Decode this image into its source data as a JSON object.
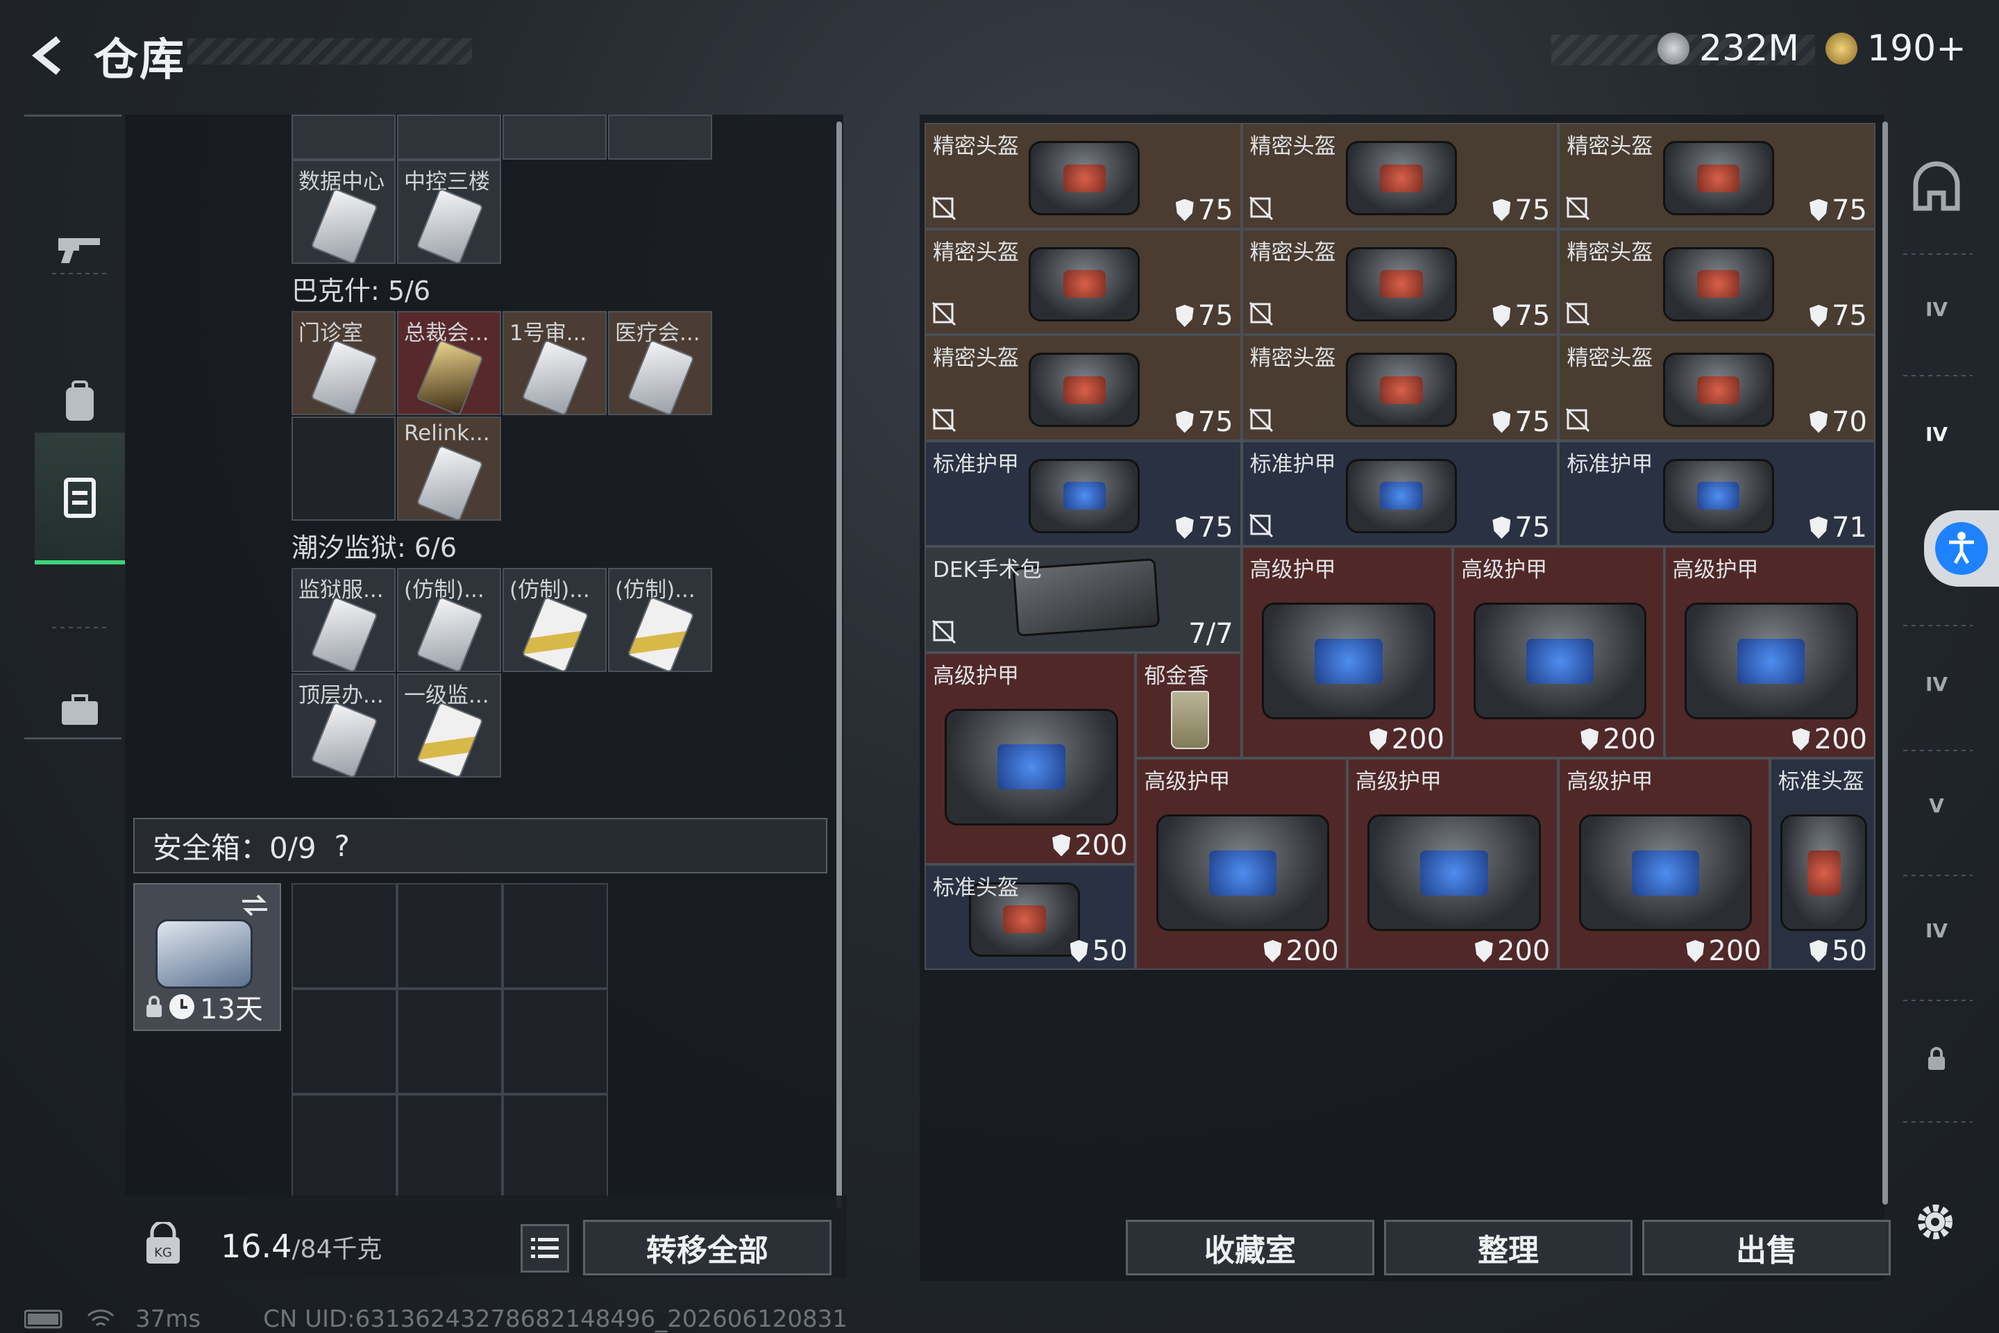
{
  "header": {
    "title": "仓库",
    "currency": [
      {
        "icon": "silver-coin-icon",
        "value": "232M"
      },
      {
        "icon": "gold-coin-icon",
        "value": "190+"
      }
    ]
  },
  "sidebar": {
    "items": [
      {
        "name": "weapon-icon"
      },
      {
        "name": "backpack-icon"
      },
      {
        "name": "armor-vest-icon",
        "active": true
      },
      {
        "name": "briefcase-icon"
      }
    ]
  },
  "stash": {
    "top_cells": [
      {
        "label": "数据中心"
      },
      {
        "label": "中控三楼"
      }
    ],
    "bakshi": {
      "title": "巴克什: 5/6",
      "cells": [
        {
          "label": "门诊室"
        },
        {
          "label": "总裁会..."
        },
        {
          "label": "1号审..."
        },
        {
          "label": "医疗会..."
        },
        {
          "label": "Relink..."
        }
      ]
    },
    "prison": {
      "title": "潮汐监狱: 6/6",
      "cells": [
        {
          "label": "监狱服..."
        },
        {
          "label": "(仿制)..."
        },
        {
          "label": "(仿制)..."
        },
        {
          "label": "(仿制)..."
        },
        {
          "label": "顶层办..."
        },
        {
          "label": "一级监..."
        }
      ]
    }
  },
  "safe_box": {
    "label": "安全箱：0/9",
    "help": "?",
    "item_timer": "13天"
  },
  "weight": {
    "current": "16.4",
    "max": "/84千克"
  },
  "buttons": {
    "transfer_all": "转移全部",
    "collection": "收藏室",
    "organize": "整理",
    "sell": "出售"
  },
  "items": [
    {
      "label": "精密头盔",
      "value": "75"
    },
    {
      "label": "精密头盔",
      "value": "75"
    },
    {
      "label": "精密头盔",
      "value": "75"
    },
    {
      "label": "精密头盔",
      "value": "75"
    },
    {
      "label": "精密头盔",
      "value": "75"
    },
    {
      "label": "精密头盔",
      "value": "75"
    },
    {
      "label": "精密头盔",
      "value": "75"
    },
    {
      "label": "精密头盔",
      "value": "75"
    },
    {
      "label": "精密头盔",
      "value": "70"
    },
    {
      "label": "标准护甲",
      "value": "75"
    },
    {
      "label": "标准护甲",
      "value": "75"
    },
    {
      "label": "标准护甲",
      "value": "71"
    },
    {
      "label": "DEK手术包",
      "value": "7/7"
    },
    {
      "label": "高级护甲",
      "value": "200"
    },
    {
      "label": "高级护甲",
      "value": "200"
    },
    {
      "label": "高级护甲",
      "value": "200"
    },
    {
      "label": "高级护甲",
      "value": "200"
    },
    {
      "label": "郁金香",
      "value": ""
    },
    {
      "label": "高级护甲",
      "value": "200"
    },
    {
      "label": "高级护甲",
      "value": "200"
    },
    {
      "label": "高级护甲",
      "value": "200"
    },
    {
      "label": "标准头盔",
      "value": "50"
    },
    {
      "label": "标准头盔",
      "value": "50"
    }
  ],
  "right_tools": [
    "helmet-slot-icon",
    "IV",
    "IV",
    "IV",
    "IV",
    "V",
    "IV"
  ],
  "status": {
    "ping": "37ms",
    "uid": "CN UID:6313624327868214849​6_202606120831"
  },
  "colors": {
    "accent_green": "#3dd47a",
    "access_blue": "#1e82ff"
  }
}
